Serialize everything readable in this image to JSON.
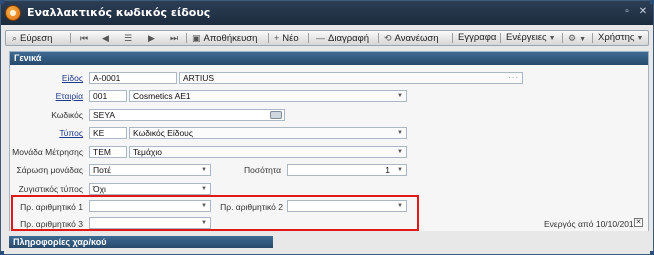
{
  "window": {
    "title": "Εναλλακτικός κωδικός είδους"
  },
  "toolbar": {
    "search": "Εύρεση",
    "save": "Αποθήκευση",
    "new": "Νέο",
    "delete": "Διαγραφή",
    "refresh": "Ανανέωση",
    "documents": "Εγγραφα",
    "actions": "Ενέργειες",
    "users": "Χρήστης"
  },
  "section_general": "Γενικά",
  "section_info": "Πληροφορίες χαρ/κού",
  "fields": {
    "item": {
      "label": "Είδος",
      "code": "A-0001",
      "name": "ARTIUS"
    },
    "company": {
      "label": "Εταιρία",
      "code": "001",
      "name": "Cosmetics AE1"
    },
    "code": {
      "label": "Κωδικός",
      "value": "SEYA"
    },
    "type": {
      "label": "Τύπος",
      "code": "KE",
      "name": "Κωδικός Είδους"
    },
    "unit": {
      "label": "Μονάδα Μέτρησης",
      "code": "TEM",
      "name": "Τεμάχιο"
    },
    "unit_scan": {
      "label": "Σάρωση μονάδας",
      "value": "Ποτέ"
    },
    "quantity": {
      "label": "Ποσότητα",
      "value": "1"
    },
    "weighing_type": {
      "label": "Ζυγιστικός τύπος",
      "value": "Όχι"
    },
    "num1": {
      "label": "Πρ. αριθμητικό 1",
      "value": ""
    },
    "num2": {
      "label": "Πρ. αριθμητικό 2",
      "value": ""
    },
    "num3": {
      "label": "Πρ. αριθμητικό 3",
      "value": ""
    }
  },
  "status": {
    "active_since": "Ενεργός από 10/10/2013",
    "checkbox": "✕"
  },
  "colors": {
    "titlebar": "#1c2b3e",
    "panel_header": "#274a6b",
    "highlight": "#e01818"
  }
}
